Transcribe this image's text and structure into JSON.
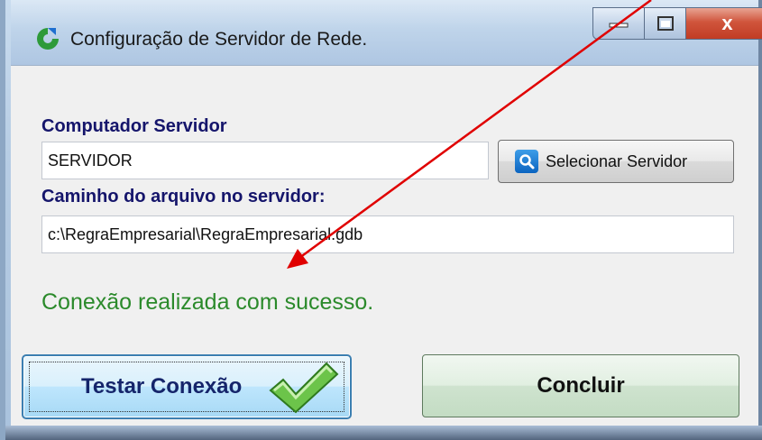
{
  "window": {
    "title": "Configuração de Servidor de Rede.",
    "buttons": {
      "minimize": "minimize-icon",
      "maximize": "maximize-icon",
      "close": "x"
    }
  },
  "server": {
    "label": "Computador Servidor",
    "value": "SERVIDOR",
    "select_button_label": "Selecionar Servidor",
    "select_button_icon": "search-icon"
  },
  "path": {
    "label": "Caminho do arquivo no servidor:",
    "value": "c:\\RegraEmpresarial\\RegraEmpresarial.gdb"
  },
  "status": {
    "message": "Conexão realizada com sucesso.",
    "color": "#2b8a2b"
  },
  "actions": {
    "test_label": "Testar Conexão",
    "test_icon": "checkmark-icon",
    "done_label": "Concluir"
  },
  "annotation": {
    "arrow_color": "#e00000"
  }
}
